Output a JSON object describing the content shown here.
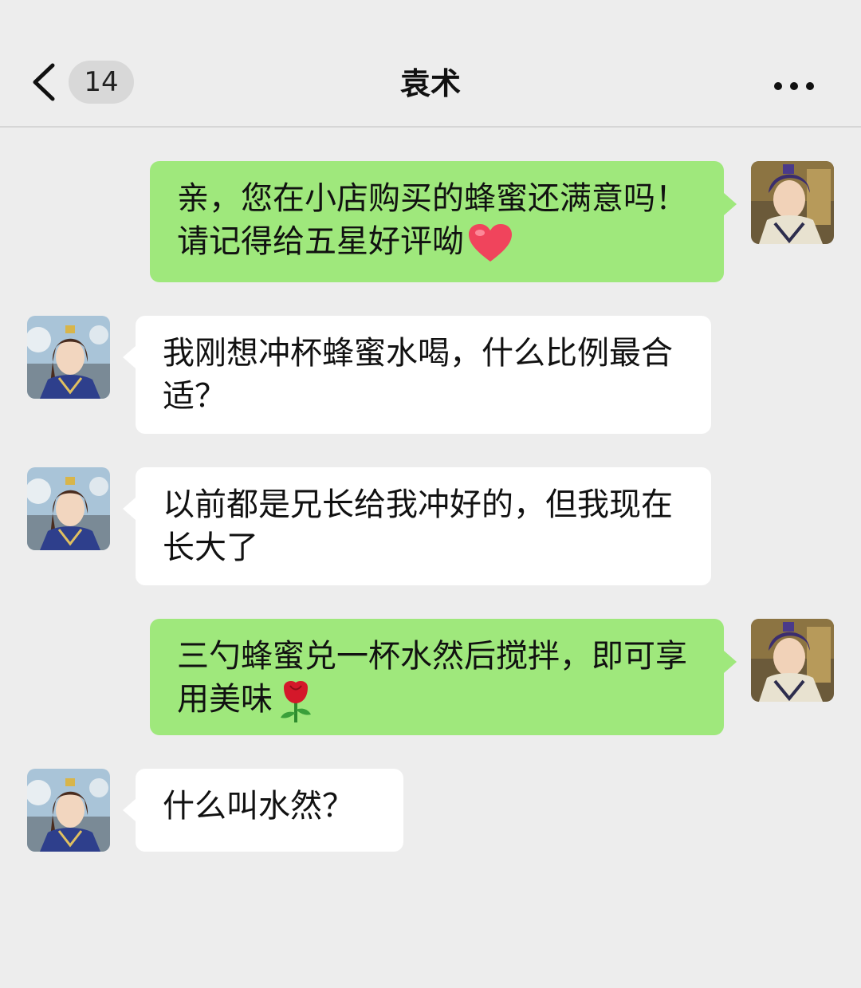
{
  "header": {
    "unread_count": "14",
    "title": "袁术",
    "back_icon": "chevron-left-icon",
    "more_icon": "more-dots-icon"
  },
  "messages": [
    {
      "from": "me",
      "text": "亲，您在小店购买的蜂蜜还满意吗！请记得给五星好评呦",
      "emoji": "heart-emoji"
    },
    {
      "from": "other",
      "text": "我刚想冲杯蜂蜜水喝，什么比例最合适？"
    },
    {
      "from": "other",
      "text": "以前都是兄长给我冲好的，但我现在长大了"
    },
    {
      "from": "me",
      "text": "三勺蜂蜜兑一杯水然后搅拌，即可享用美味",
      "emoji": "rose-emoji"
    },
    {
      "from": "other",
      "text": "什么叫水然？"
    }
  ],
  "colors": {
    "background": "#ededed",
    "my_bubble": "#9fe87c",
    "other_bubble": "#ffffff"
  }
}
